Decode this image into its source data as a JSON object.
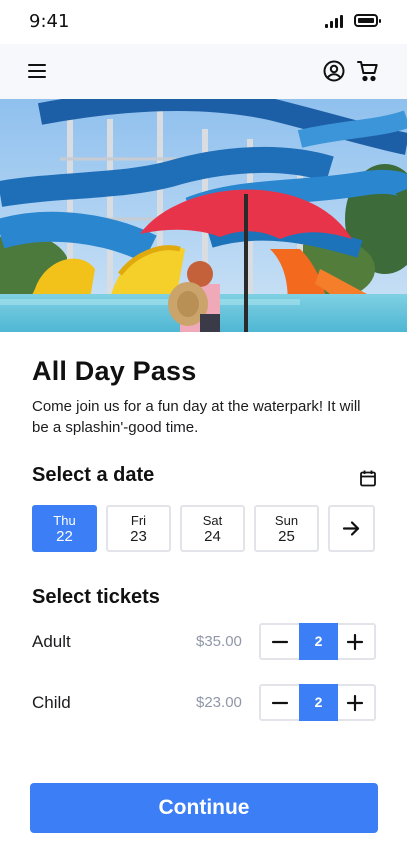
{
  "status_bar": {
    "time": "9:41"
  },
  "nav": {
    "menu_icon": "hamburger-menu-icon",
    "account_icon": "user-circle-icon",
    "cart_icon": "shopping-cart-icon"
  },
  "hero": {
    "icon": "waterpark-photo"
  },
  "product": {
    "title": "All Day Pass",
    "description": "Come join us for a fun day at the waterpark! It will be a splashin'-good time."
  },
  "date_section": {
    "title": "Select a date",
    "calendar_icon": "calendar-icon",
    "next_icon": "arrow-right-icon",
    "dates": [
      {
        "dow": "Thu",
        "day": "22",
        "selected": true
      },
      {
        "dow": "Fri",
        "day": "23",
        "selected": false
      },
      {
        "dow": "Sat",
        "day": "24",
        "selected": false
      },
      {
        "dow": "Sun",
        "day": "25",
        "selected": false
      }
    ]
  },
  "tickets_section": {
    "title": "Select tickets",
    "tickets": [
      {
        "label": "Adult",
        "price": "$35.00",
        "quantity": "2"
      },
      {
        "label": "Child",
        "price": "$23.00",
        "quantity": "2"
      }
    ]
  },
  "cta": {
    "label": "Continue"
  },
  "colors": {
    "accent": "#3c7ef5",
    "nav_background": "#f7f8fb",
    "price_text": "#8f97a8",
    "chip_border": "#e2e4ea"
  }
}
